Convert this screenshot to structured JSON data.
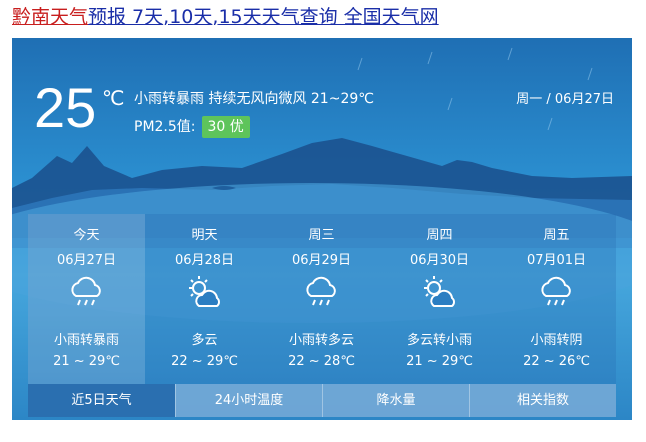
{
  "header": {
    "parts": [
      {
        "text": "黔南天气",
        "color": "#c81e1e"
      },
      {
        "text": "预报 7天",
        "color": "#1a2ea8"
      },
      {
        "text": ",",
        "color": "#1a2ea8"
      },
      {
        "text": "10天",
        "color": "#1a2ea8"
      },
      {
        "text": ",",
        "color": "#1a2ea8"
      },
      {
        "text": "15天天气查询 全国天气网",
        "color": "#1a2ea8"
      }
    ]
  },
  "current": {
    "temp": "25",
    "unit": "℃",
    "condition": "小雨转暴雨   持续无风向微风   21~29℃",
    "pm_label": "PM2.5值:",
    "aqi": "30 优",
    "aqi_color": "#5ec45b",
    "date": "周一 / 06月27日"
  },
  "forecast": [
    {
      "name": "今天",
      "date": "06月27日",
      "icon": "cloud-rain-icon",
      "cond": "小雨转暴雨",
      "range": "21 ~ 29℃"
    },
    {
      "name": "明天",
      "date": "06月28日",
      "icon": "partly-cloudy-icon",
      "cond": "多云",
      "range": "22 ~ 29℃"
    },
    {
      "name": "周三",
      "date": "06月29日",
      "icon": "cloud-rain-icon",
      "cond": "小雨转多云",
      "range": "22 ~ 28℃"
    },
    {
      "name": "周四",
      "date": "06月30日",
      "icon": "partly-cloudy-icon",
      "cond": "多云转小雨",
      "range": "21 ~ 29℃"
    },
    {
      "name": "周五",
      "date": "07月01日",
      "icon": "cloud-rain-icon",
      "cond": "小雨转阴",
      "range": "22 ~ 26℃"
    }
  ],
  "tabs": [
    "近5日天气",
    "24小时温度",
    "降水量",
    "相关指数"
  ]
}
